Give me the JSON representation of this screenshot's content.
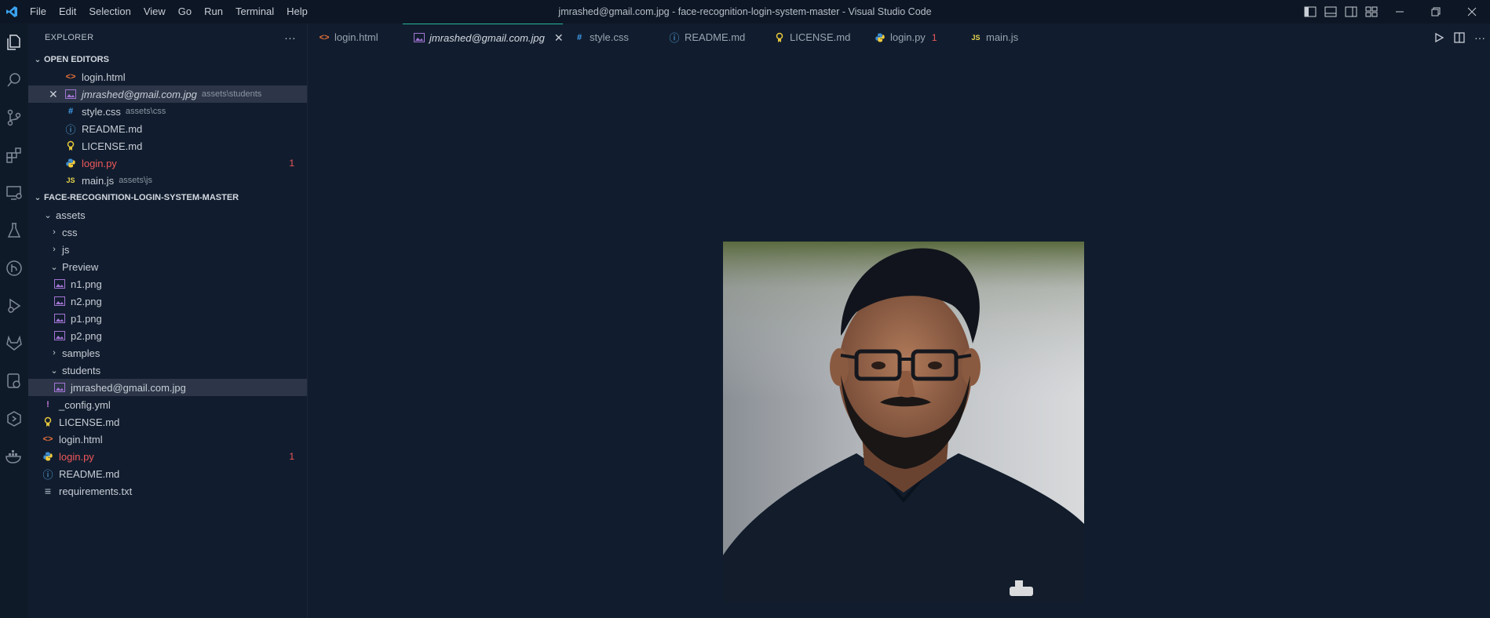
{
  "window": {
    "title": "jmrashed@gmail.com.jpg - face-recognition-login-system-master - Visual Studio Code"
  },
  "menu": [
    "File",
    "Edit",
    "Selection",
    "View",
    "Go",
    "Run",
    "Terminal",
    "Help"
  ],
  "explorer": {
    "title": "EXPLORER",
    "more_label": "···",
    "open_editors": {
      "label": "OPEN EDITORS",
      "items": [
        {
          "name": "login.html",
          "desc": "",
          "icon": "html-icon",
          "badge": ""
        },
        {
          "name": "jmrashed@gmail.com.jpg",
          "desc": "assets\\students",
          "icon": "image-icon",
          "badge": ""
        },
        {
          "name": "style.css",
          "desc": "assets\\css",
          "icon": "css-icon",
          "badge": ""
        },
        {
          "name": "README.md",
          "desc": "",
          "icon": "info-icon",
          "badge": ""
        },
        {
          "name": "LICENSE.md",
          "desc": "",
          "icon": "license-icon",
          "badge": ""
        },
        {
          "name": "login.py",
          "desc": "",
          "icon": "python-icon",
          "badge": "1"
        },
        {
          "name": "main.js",
          "desc": "assets\\js",
          "icon": "js-icon",
          "badge": ""
        }
      ]
    },
    "project": {
      "label": "FACE-RECOGNITION-LOGIN-SYSTEM-MASTER",
      "tree": [
        {
          "name": "assets",
          "type": "folder-open"
        },
        {
          "name": "css",
          "type": "folder-closed"
        },
        {
          "name": "js",
          "type": "folder-closed"
        },
        {
          "name": "Preview",
          "type": "folder-open"
        },
        {
          "name": "n1.png",
          "type": "image"
        },
        {
          "name": "n2.png",
          "type": "image"
        },
        {
          "name": "p1.png",
          "type": "image"
        },
        {
          "name": "p2.png",
          "type": "image"
        },
        {
          "name": "samples",
          "type": "folder-closed"
        },
        {
          "name": "students",
          "type": "folder-open"
        },
        {
          "name": "jmrashed@gmail.com.jpg",
          "type": "image"
        },
        {
          "name": "_config.yml",
          "type": "yml"
        },
        {
          "name": "LICENSE.md",
          "type": "license"
        },
        {
          "name": "login.html",
          "type": "html"
        },
        {
          "name": "login.py",
          "type": "python",
          "badge": "1"
        },
        {
          "name": "README.md",
          "type": "info"
        },
        {
          "name": "requirements.txt",
          "type": "text"
        }
      ]
    }
  },
  "tabs": [
    {
      "label": "login.html",
      "icon": "html-icon"
    },
    {
      "label": "jmrashed@gmail.com.jpg",
      "icon": "image-icon",
      "active": true
    },
    {
      "label": "style.css",
      "icon": "css-icon"
    },
    {
      "label": "README.md",
      "icon": "info-icon"
    },
    {
      "label": "LICENSE.md",
      "icon": "license-icon"
    },
    {
      "label": "login.py",
      "icon": "python-icon",
      "badge": "1"
    },
    {
      "label": "main.js",
      "icon": "js-icon"
    }
  ],
  "glyphs": {
    "html": "<>",
    "css": "#",
    "info": "ⓘ",
    "js": "JS",
    "yml": "!",
    "text": "≡",
    "close": "✕",
    "chev_down": "⌄",
    "chev_right": "›"
  },
  "colors": {
    "accent_tab": "#2bb5a0",
    "error": "#f0575a",
    "editor_bg": "#111d2e"
  }
}
